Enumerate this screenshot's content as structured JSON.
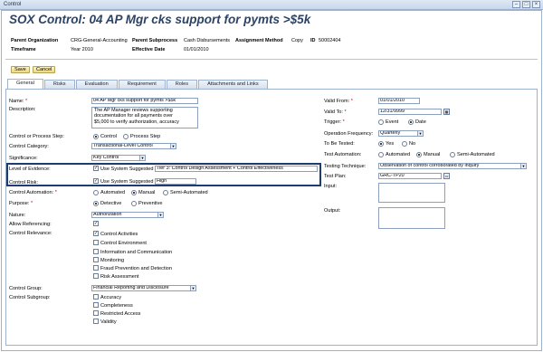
{
  "window": {
    "title": "Control"
  },
  "header": {
    "title": "SOX Control: 04 AP Mgr cks support for pymts >$5k",
    "parent_org_label": "Parent Organization",
    "parent_org_value": "CRG-General-Accounting",
    "parent_subprocess_label": "Parent Subprocess",
    "parent_subprocess_value": "Cash Disbursements",
    "assignment_method_label": "Assignment Method",
    "assignment_method_value": "Copy",
    "id_label": "ID",
    "id_value": "50002404",
    "timeframe_label": "Timeframe",
    "timeframe_value": "Year 2010",
    "effective_date_label": "Effective Date",
    "effective_date_value": "01/01/2010"
  },
  "toolbar": {
    "save_label": "Save",
    "cancel_label": "Cancel"
  },
  "tabs": [
    "General",
    "Risks",
    "Evaluation",
    "Requirement",
    "Roles",
    "Attachments and Links"
  ],
  "left": {
    "name_label": "Name:",
    "name_value": "04 AP Mgr cks support for pymts >$5k",
    "description_label": "Description:",
    "description_lines": [
      "The AP Manager reviews supporting",
      "documentation for all payments over",
      "$5,000 to verify authorization, accuracy"
    ],
    "control_process_label": "Control or Process Step:",
    "control_option": "Control",
    "process_option": "Process Step",
    "control_category_label": "Control Category:",
    "control_category_value": "Transactional-Level Control",
    "significance_label": "Significance:",
    "significance_value": "Key Control",
    "level_evidence_label": "Level of Evidence:",
    "use_system_suggested": "Use System Suggested",
    "level_evidence_value": "Tier 3: Control Design Assessment + Control Effectiveness",
    "control_risk_label": "Control Risk:",
    "control_risk_value": "High",
    "control_automation_label": "Control Automation:",
    "automated": "Automated",
    "manual": "Manual",
    "semi_automated": "Semi-Automated",
    "purpose_label": "Purpose:",
    "detective": "Detective",
    "preventive": "Preventive",
    "nature_label": "Nature:",
    "nature_value": "Authorization",
    "allow_referencing_label": "Allow Referencing:",
    "control_relevance_label": "Control Relevance:",
    "relevance": [
      "Control Activities",
      "Control Environment",
      "Information and Communication",
      "Monitoring",
      "Fraud Prevention and Detection",
      "Risk Assessment"
    ],
    "control_group_label": "Control Group:",
    "control_group_value": "Financial Reporting and Disclosure",
    "control_subgroup_label": "Control Subgroup:",
    "subgroups": [
      "Accuracy",
      "Completeness",
      "Restricted Access",
      "Validity"
    ]
  },
  "right": {
    "valid_from_label": "Valid From:",
    "valid_from_value": "01/01/2010",
    "valid_to_label": "Valid To:",
    "valid_to_value": "12/31/9999",
    "trigger_label": "Trigger:",
    "event": "Event",
    "date": "Date",
    "operation_freq_label": "Operation Frequency:",
    "operation_freq_value": "Quarterly",
    "to_be_tested_label": "To Be Tested:",
    "yes": "Yes",
    "no": "No",
    "test_automation_label": "Test Automation:",
    "automated": "Automated",
    "manual": "Manual",
    "semi_automated": "Semi-Automated",
    "testing_technique_label": "Testing Technique:",
    "testing_technique_value": "Observation of control corroborated by inquiry",
    "test_plan_label": "Test Plan:",
    "test_plan_value": "GRC-TP20",
    "input_label": "Input:",
    "output_label": "Output:"
  }
}
